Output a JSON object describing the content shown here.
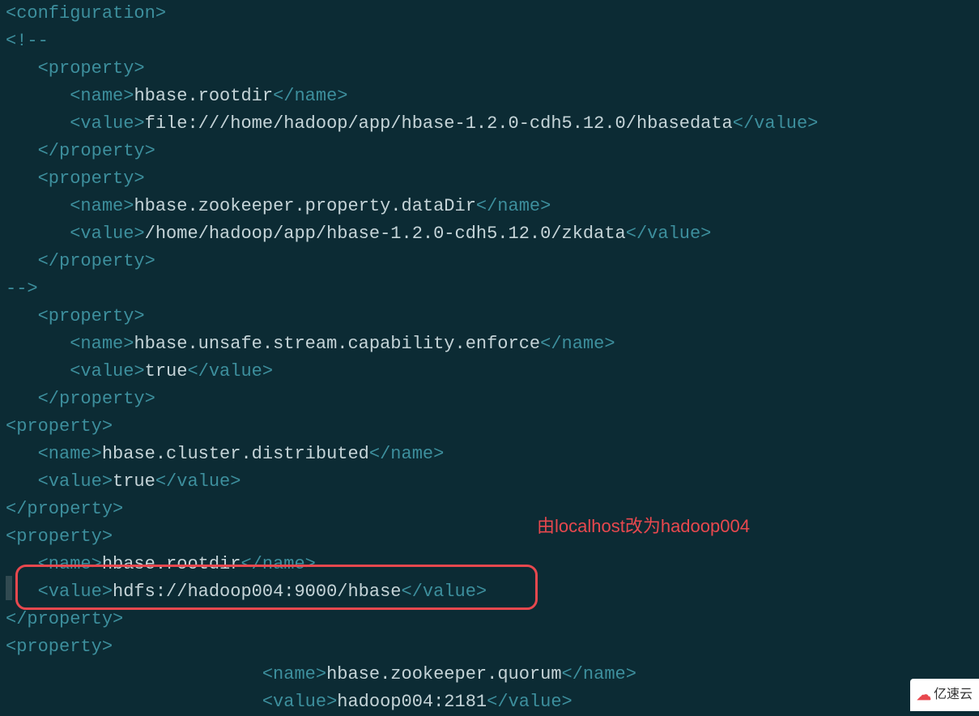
{
  "code": {
    "lines": [
      {
        "indent": 0,
        "type": "tag-open",
        "tag": "configuration"
      },
      {
        "indent": 0,
        "type": "comment-open"
      },
      {
        "indent": 1,
        "type": "tag-open",
        "tag": "property"
      },
      {
        "indent": 2,
        "type": "named",
        "tag": "name",
        "content": "hbase.rootdir"
      },
      {
        "indent": 2,
        "type": "named",
        "tag": "value",
        "content": "file:///home/hadoop/app/hbase-1.2.0-cdh5.12.0/hbasedata"
      },
      {
        "indent": 1,
        "type": "tag-close",
        "tag": "property"
      },
      {
        "indent": 1,
        "type": "tag-open",
        "tag": "property"
      },
      {
        "indent": 2,
        "type": "named",
        "tag": "name",
        "content": "hbase.zookeeper.property.dataDir"
      },
      {
        "indent": 2,
        "type": "named",
        "tag": "value",
        "content": "/home/hadoop/app/hbase-1.2.0-cdh5.12.0/zkdata"
      },
      {
        "indent": 1,
        "type": "tag-close",
        "tag": "property"
      },
      {
        "indent": 0,
        "type": "comment-close"
      },
      {
        "indent": 1,
        "type": "tag-open",
        "tag": "property"
      },
      {
        "indent": 2,
        "type": "named",
        "tag": "name",
        "content": "hbase.unsafe.stream.capability.enforce"
      },
      {
        "indent": 2,
        "type": "named",
        "tag": "value",
        "content": "true"
      },
      {
        "indent": 1,
        "type": "tag-close",
        "tag": "property"
      },
      {
        "indent": 0,
        "type": "tag-open",
        "tag": "property"
      },
      {
        "indent": 1,
        "type": "named",
        "tag": "name",
        "content": "hbase.cluster.distributed"
      },
      {
        "indent": 1,
        "type": "named",
        "tag": "value",
        "content": "true"
      },
      {
        "indent": 0,
        "type": "tag-close",
        "tag": "property"
      },
      {
        "indent": 0,
        "type": "tag-open",
        "tag": "property"
      },
      {
        "indent": 1,
        "type": "named",
        "tag": "name",
        "content": "hbase.rootdir"
      },
      {
        "indent": 1,
        "type": "named",
        "tag": "value",
        "content": "hdfs://hadoop004:9000/hbase"
      },
      {
        "indent": 0,
        "type": "tag-close",
        "tag": "property"
      },
      {
        "indent": 0,
        "type": "tag-open",
        "tag": "property"
      },
      {
        "indent": 8,
        "type": "named",
        "tag": "name",
        "content": "hbase.zookeeper.quorum"
      },
      {
        "indent": 8,
        "type": "named",
        "tag": "value",
        "content": "hadoop004:2181"
      }
    ]
  },
  "annotation": {
    "text": "由localhost改为hadoop004"
  },
  "watermark": {
    "text": "亿速云"
  }
}
